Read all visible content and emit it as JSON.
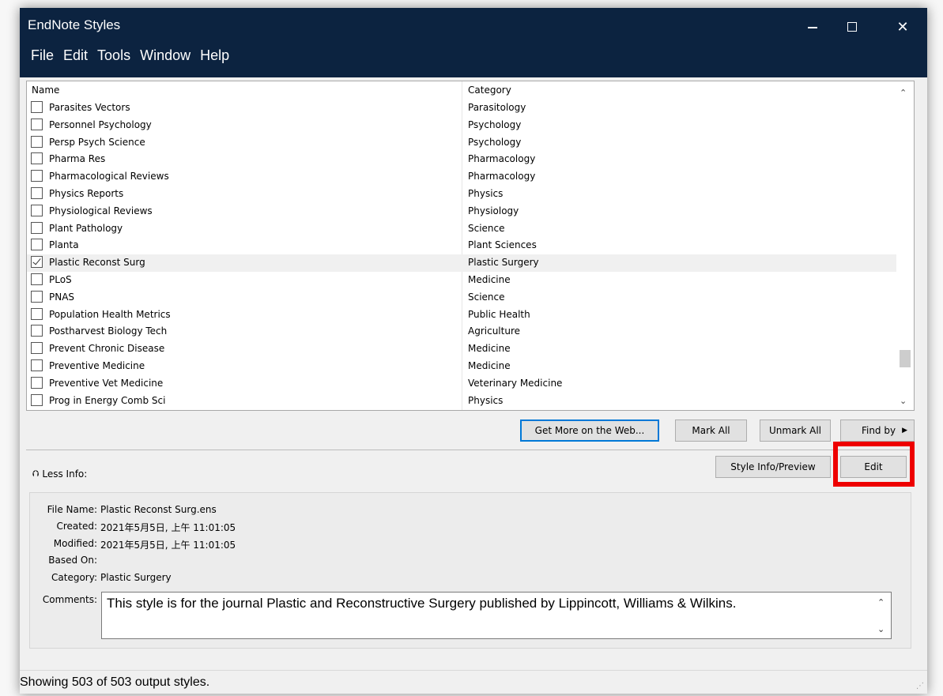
{
  "window": {
    "title": "EndNote Styles",
    "controls": {
      "minimize": "—",
      "maximize": "☐",
      "close": "✕"
    }
  },
  "menu": [
    "File",
    "Edit",
    "Tools",
    "Window",
    "Help"
  ],
  "list": {
    "headers": {
      "name": "Name",
      "category": "Category"
    },
    "rows": [
      {
        "name": "Parasites Vectors",
        "category": "Parasitology",
        "checked": false
      },
      {
        "name": "Personnel Psychology",
        "category": "Psychology",
        "checked": false
      },
      {
        "name": "Persp Psych Science",
        "category": "Psychology",
        "checked": false
      },
      {
        "name": "Pharma Res",
        "category": "Pharmacology",
        "checked": false
      },
      {
        "name": "Pharmacological Reviews",
        "category": "Pharmacology",
        "checked": false
      },
      {
        "name": "Physics Reports",
        "category": "Physics",
        "checked": false
      },
      {
        "name": "Physiological Reviews",
        "category": "Physiology",
        "checked": false
      },
      {
        "name": "Plant Pathology",
        "category": "Science",
        "checked": false
      },
      {
        "name": "Planta",
        "category": "Plant Sciences",
        "checked": false
      },
      {
        "name": "Plastic Reconst Surg",
        "category": "Plastic Surgery",
        "checked": true,
        "selected": true
      },
      {
        "name": "PLoS",
        "category": "Medicine",
        "checked": false
      },
      {
        "name": "PNAS",
        "category": "Science",
        "checked": false
      },
      {
        "name": "Population Health Metrics",
        "category": "Public Health",
        "checked": false
      },
      {
        "name": "Postharvest Biology Tech",
        "category": "Agriculture",
        "checked": false
      },
      {
        "name": "Prevent Chronic Disease",
        "category": "Medicine",
        "checked": false
      },
      {
        "name": "Preventive Medicine",
        "category": "Medicine",
        "checked": false
      },
      {
        "name": "Preventive Vet Medicine",
        "category": "Veterinary Medicine",
        "checked": false
      },
      {
        "name": "Prog in Energy Comb Sci",
        "category": "Physics",
        "checked": false
      }
    ]
  },
  "buttons": {
    "get_more": "Get More on the Web...",
    "mark_all": "Mark All",
    "unmark_all": "Unmark All",
    "find_by": "Find by",
    "style_info": "Style Info/Preview",
    "edit": "Edit"
  },
  "less_info": "Less Info:",
  "info": {
    "file_name_label": "File Name:",
    "file_name": "Plastic Reconst Surg.ens",
    "created_label": "Created:",
    "created": "2021年5月5日, 上午 11:01:05",
    "modified_label": "Modified:",
    "modified": "2021年5月5日, 上午 11:01:05",
    "based_on_label": "Based On:",
    "based_on": "",
    "category_label": "Category:",
    "category": "Plastic Surgery",
    "comments_label": "Comments:",
    "comments": "This style is for the journal Plastic and Reconstructive Surgery published by Lippincott, Williams & Wilkins."
  },
  "status": "Showing 503 of 503 output styles.",
  "colors": {
    "titlebar": "#0c2340",
    "highlight": "#ee0000",
    "default_button_border": "#0078d7"
  }
}
